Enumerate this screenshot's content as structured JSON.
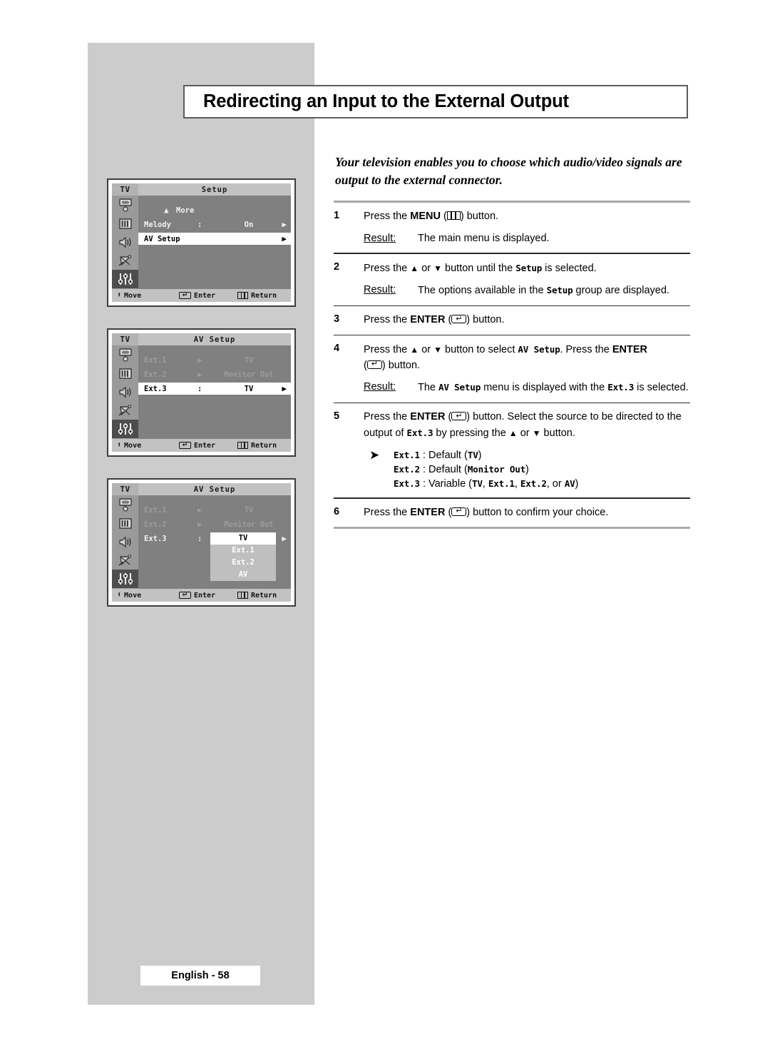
{
  "page": {
    "title": "Redirecting an Input to the External Output",
    "intro": "Your television enables you to choose which audio/video signals are output to the external connector.",
    "footer": "English - 58"
  },
  "steps": [
    {
      "num": "1",
      "pre": "Press the ",
      "bold1": "MENU",
      "icon": "menu-icon",
      "post": " button.",
      "result_label": "Result:",
      "result": "The main menu is displayed."
    },
    {
      "num": "2",
      "text_a": "Press the ",
      "text_b": " or ",
      "text_c": " button until the ",
      "mono1": "Setup",
      "text_d": " is selected.",
      "result_label": "Result:",
      "result_a": "The options available in the ",
      "result_mono": "Setup",
      "result_b": " group are displayed."
    },
    {
      "num": "3",
      "pre": "Press the ",
      "bold1": "ENTER",
      "icon": "enter-icon",
      "post": " button."
    },
    {
      "num": "4",
      "text_a": "Press the ",
      "text_b": " or ",
      "text_c": " button to select ",
      "mono1": "AV Setup",
      "text_d": ". Press the ",
      "bold1": "ENTER",
      "text_e": ") button.",
      "result_label": "Result:",
      "result_a": "The ",
      "result_mono1": "AV Setup",
      "result_b": " menu is displayed with the ",
      "result_mono2": "Ext.3",
      "result_c": " is selected."
    },
    {
      "num": "5",
      "text_a": "Press the ",
      "bold1": "ENTER",
      "text_b": ") button. Select the source to be directed to the output of ",
      "mono1": "Ext.3",
      "text_c": " by pressing the ",
      "text_d": " or ",
      "text_e": " button.",
      "bullets": [
        {
          "mono": "Ext.1",
          "mid": " : Default (",
          "val": "TV",
          "end": ")"
        },
        {
          "mono": "Ext.2",
          "mid": " : Default (",
          "val": "Monitor Out",
          "end": ")"
        },
        {
          "mono": "Ext.3",
          "mid": " : Variable (",
          "val": "TV",
          "v2": "Ext.1",
          "v3": "Ext.2",
          "v4": "AV",
          "end": ")"
        }
      ]
    },
    {
      "num": "6",
      "pre": "Press the ",
      "bold1": "ENTER",
      "icon": "enter-icon",
      "post": ") button to confirm your choice."
    }
  ],
  "osd": {
    "tv_label": "TV",
    "bottom": {
      "move": "Move",
      "enter": "Enter",
      "return": "Return"
    },
    "screens": [
      {
        "title": "Setup",
        "more_label": "More",
        "rows": [
          {
            "style": "norm",
            "c1": "Melody",
            "c2": ":",
            "c3": "On",
            "c4": "▶"
          },
          {
            "style": "sel",
            "c1": "AV Setup",
            "c2": "",
            "c3": "",
            "c4": "▶"
          }
        ]
      },
      {
        "title": "AV Setup",
        "rows": [
          {
            "style": "dim",
            "c1": "Ext.1",
            "c2": "▶",
            "c3": "TV",
            "c4": ""
          },
          {
            "style": "dim",
            "c1": "Ext.2",
            "c2": "▶",
            "c3": "Monitor Out",
            "c4": ""
          },
          {
            "style": "sel",
            "c1": "Ext.3",
            "c2": ":",
            "c3": "TV",
            "c4": "▶"
          }
        ]
      },
      {
        "title": "AV Setup",
        "rows": [
          {
            "style": "dim",
            "c1": "Ext.1",
            "c2": "▶",
            "c3": "TV",
            "c4": ""
          },
          {
            "style": "dim",
            "c1": "Ext.2",
            "c2": "▶",
            "c3": "Monitor Out",
            "c4": ""
          },
          {
            "style": "norm",
            "c1": "Ext.3",
            "c2": ":",
            "c3": "",
            "c4": "▶"
          }
        ],
        "dropdown": {
          "selected": "TV",
          "options": [
            "Ext.1",
            "Ext.2",
            "AV"
          ]
        }
      }
    ]
  }
}
